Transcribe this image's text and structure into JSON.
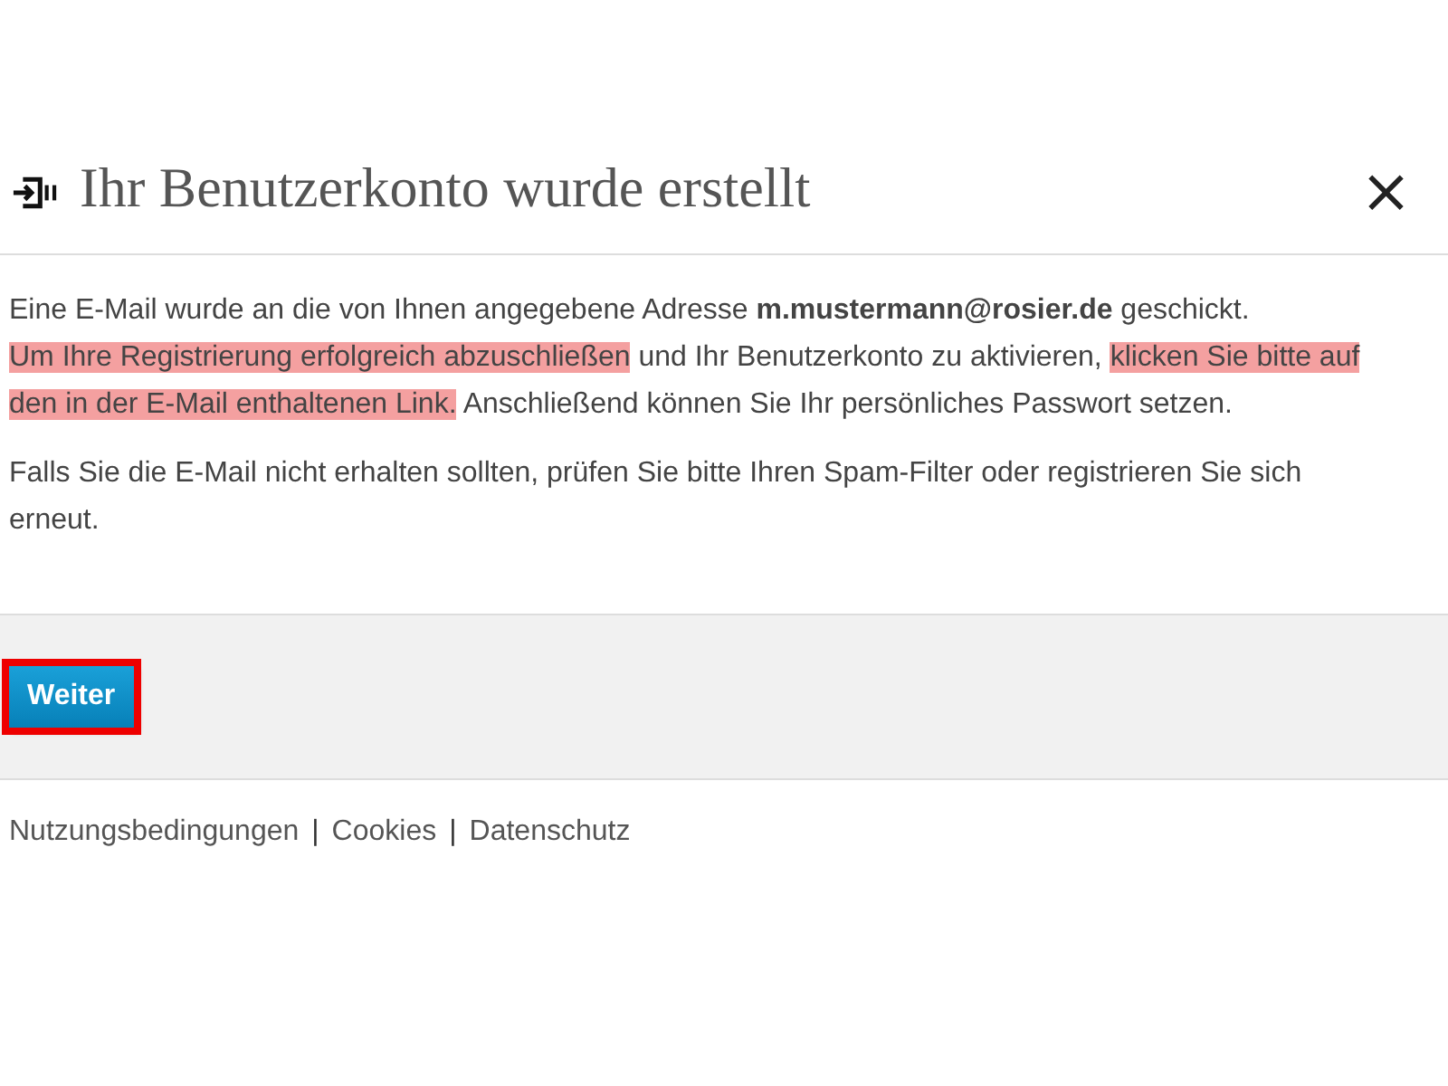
{
  "dialog": {
    "title": "Ihr Benutzerkonto wurde erstellt",
    "close": "×"
  },
  "paragraphs": [
    {
      "lines": [
        {
          "segments": [
            {
              "text": "Eine E-Mail wurde an die von Ihnen angegebene Adresse **m.mustermann@rosier.de** geschickt.",
              "highlighted": false
            }
          ]
        },
        {
          "segments": [
            {
              "text": "Um Ihre Registrierung erfolgreich abzuschließen",
              "highlighted": true
            },
            {
              "text": " und Ihr Benutzerkonto zu aktivieren, ",
              "highlighted": false
            },
            {
              "text": "klicken Sie bitte auf den in der E-Mail enthaltenen Link.",
              "highlighted": true
            },
            {
              "text": " Anschließend können Sie Ihr persönliches Passwort setzen.",
              "highlighted": false
            }
          ]
        }
      ]
    },
    {
      "lines": [
        {
          "segments": [
            {
              "text": "Falls Sie die E-Mail nicht erhalten sollten, prüfen Sie bitte Ihren Spam-Filter oder registrieren Sie sich erneut.",
              "highlighted": false
            }
          ]
        }
      ]
    }
  ],
  "button": {
    "label": "Weiter",
    "highlighted": true
  },
  "footer": [
    {
      "kind": "link",
      "text": "Nutzungsbedingungen"
    },
    {
      "kind": "separator",
      "text": "|"
    },
    {
      "kind": "link",
      "text": "Cookies"
    },
    {
      "kind": "separator",
      "text": "|"
    },
    {
      "kind": "link",
      "text": "Datenschutz"
    }
  ]
}
